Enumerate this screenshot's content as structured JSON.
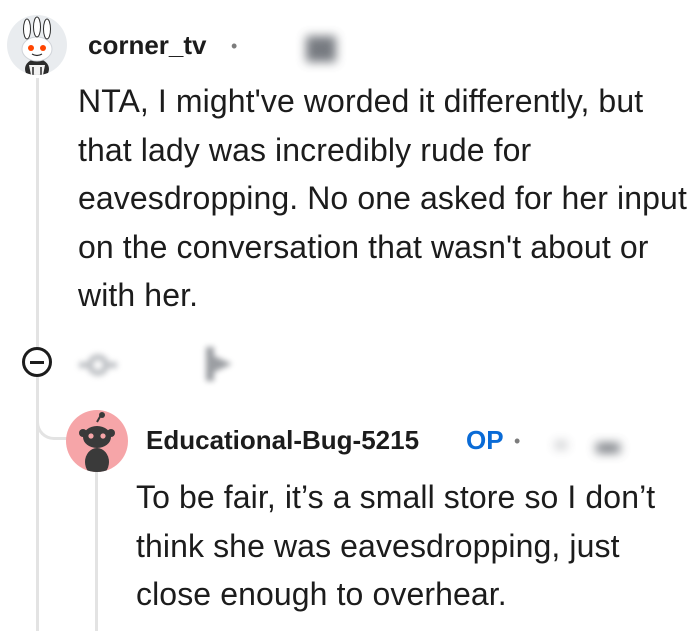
{
  "comments": [
    {
      "username": "corner_tv",
      "separator": "•",
      "text": "NTA, I might've worded it differently, but that lady was incredibly rude for eavesdropping. No one asked for her input on the conversation that wasn't about or with her."
    },
    {
      "username": "Educational-Bug-5215",
      "badge": "OP",
      "separator": "•",
      "text": "To be fair, it’s a small store so I don’t think she was eavesdropping, just close enough to overhear."
    }
  ],
  "icons": {
    "collapse": "minus-circle-icon",
    "award": "award-icon",
    "share": "share-icon"
  },
  "colors": {
    "op_badge": "#0a6bd6",
    "thread_line": "#e3e3e3",
    "reply_avatar_bg": "#f6a5a8"
  }
}
